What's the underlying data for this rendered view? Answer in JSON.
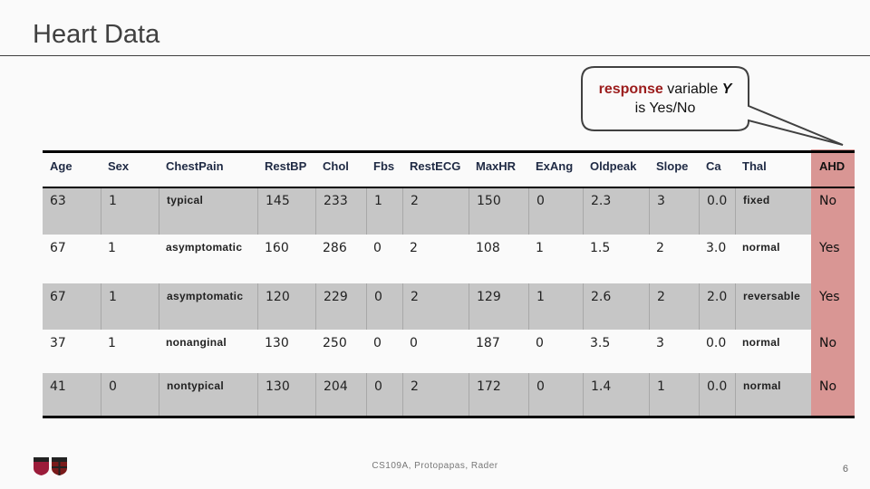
{
  "slide": {
    "title": "Heart Data",
    "page_number": "6",
    "footer": "CS109A, Protopapas, Rader"
  },
  "callout": {
    "highlight": "response",
    "middle": " variable ",
    "var": "Y",
    "line2": "is Yes/No",
    "highlight_color": "#9b1c1c"
  },
  "table": {
    "headers": [
      "Age",
      "Sex",
      "ChestPain",
      "RestBP",
      "Chol",
      "Fbs",
      "RestECG",
      "MaxHR",
      "ExAng",
      "Oldpeak",
      "Slope",
      "Ca",
      "Thal",
      "AHD"
    ],
    "rows": [
      [
        "63",
        "1",
        "typical",
        "145",
        "233",
        "1",
        "2",
        "150",
        "0",
        "2.3",
        "3",
        "0.0",
        "fixed",
        "No"
      ],
      [
        "67",
        "1",
        "asymptomatic",
        "160",
        "286",
        "0",
        "2",
        "108",
        "1",
        "1.5",
        "2",
        "3.0",
        "normal",
        "Yes"
      ],
      [
        "67",
        "1",
        "asymptomatic",
        "120",
        "229",
        "0",
        "2",
        "129",
        "1",
        "2.6",
        "2",
        "2.0",
        "reversable",
        "Yes"
      ],
      [
        "37",
        "1",
        "nonanginal",
        "130",
        "250",
        "0",
        "0",
        "187",
        "0",
        "3.5",
        "3",
        "0.0",
        "normal",
        "No"
      ],
      [
        "41",
        "0",
        "nontypical",
        "130",
        "204",
        "0",
        "2",
        "172",
        "0",
        "1.4",
        "1",
        "0.0",
        "normal",
        "No"
      ]
    ],
    "response_column_color": "#d99694",
    "stripe_color": "#c6c6c6"
  }
}
